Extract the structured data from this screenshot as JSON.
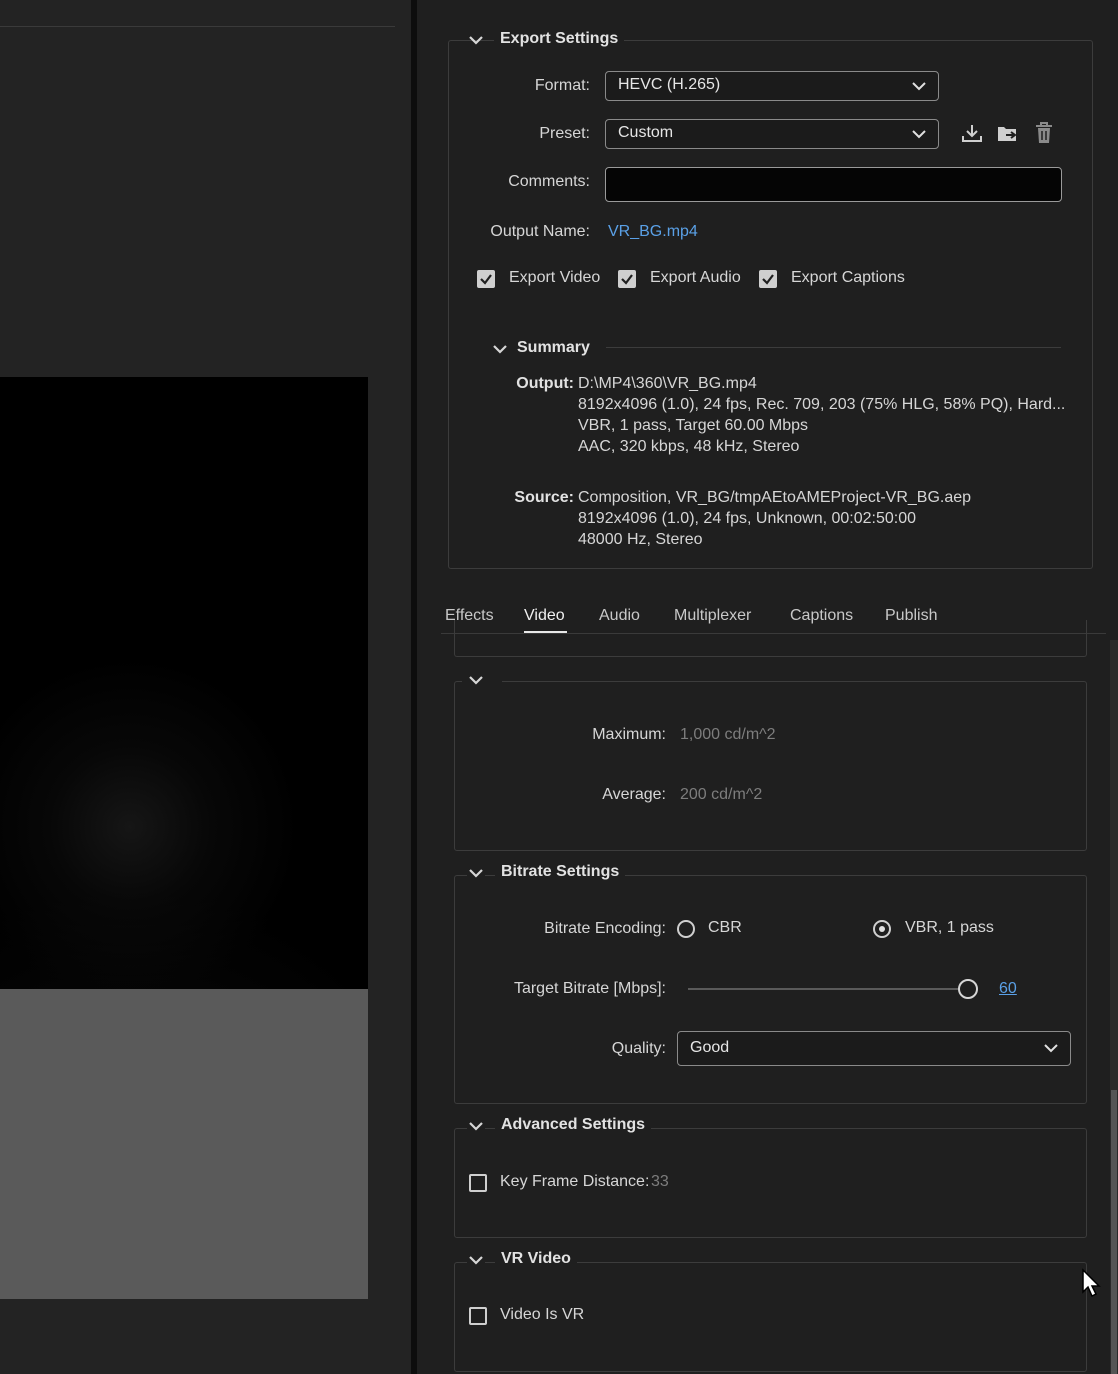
{
  "export_settings": {
    "header": "Export Settings",
    "format_label": "Format:",
    "format_value": "HEVC (H.265)",
    "preset_label": "Preset:",
    "preset_value": "Custom",
    "comments_label": "Comments:",
    "comments_value": "",
    "output_name_label": "Output Name:",
    "output_name_value": "VR_BG.mp4",
    "export_video_label": "Export Video",
    "export_video_checked": true,
    "export_audio_label": "Export Audio",
    "export_audio_checked": true,
    "export_captions_label": "Export Captions",
    "export_captions_checked": true
  },
  "summary": {
    "header": "Summary",
    "output_label": "Output:",
    "output_lines": [
      "D:\\MP4\\360\\VR_BG.mp4",
      "8192x4096 (1.0), 24 fps, Rec. 709, 203 (75% HLG, 58% PQ), Hard...",
      "VBR, 1 pass, Target 60.00 Mbps",
      "AAC, 320 kbps, 48 kHz, Stereo"
    ],
    "source_label": "Source:",
    "source_lines": [
      "Composition, VR_BG/tmpAEtoAMEProject-VR_BG.aep",
      "8192x4096 (1.0), 24 fps, Unknown, 00:02:50:00",
      "48000 Hz, Stereo"
    ]
  },
  "tabs": [
    {
      "label": "Effects",
      "active": false
    },
    {
      "label": "Video",
      "active": true
    },
    {
      "label": "Audio",
      "active": false
    },
    {
      "label": "Multiplexer",
      "active": false
    },
    {
      "label": "Captions",
      "active": false
    },
    {
      "label": "Publish",
      "active": false
    }
  ],
  "luminance": {
    "maximum_label": "Maximum:",
    "maximum_value": "1,000 cd/m^2",
    "average_label": "Average:",
    "average_value": "200 cd/m^2"
  },
  "bitrate": {
    "header": "Bitrate Settings",
    "encoding_label": "Bitrate Encoding:",
    "cbr_label": "CBR",
    "vbr_label": "VBR, 1 pass",
    "selected": "VBR, 1 pass",
    "target_label": "Target Bitrate [Mbps]:",
    "target_value": "60",
    "slider_fraction": 1.0,
    "quality_label": "Quality:",
    "quality_value": "Good"
  },
  "advanced": {
    "header": "Advanced Settings",
    "key_frame_label": "Key Frame Distance:",
    "key_frame_value": "33",
    "key_frame_checked": false
  },
  "vr": {
    "header": "VR Video",
    "video_is_vr_label": "Video Is VR",
    "video_is_vr_checked": false
  },
  "colors": {
    "link": "#5aa0e6",
    "panel_bg": "#1f1f1f",
    "border": "#3c3c3c"
  }
}
